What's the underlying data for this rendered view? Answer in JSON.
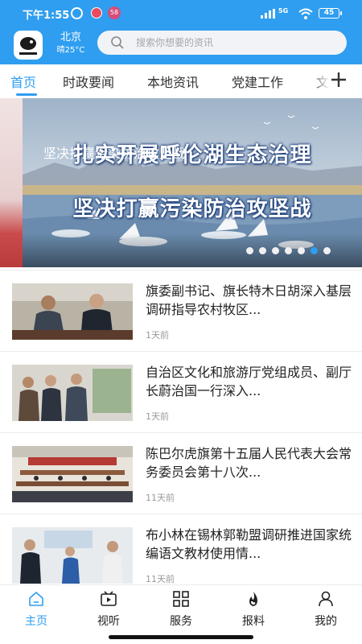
{
  "status_bar": {
    "time": "下午1:55",
    "app_badge_1": "",
    "app_badge_2": "58",
    "battery": "45",
    "network_label": "5G"
  },
  "header": {
    "city": "北京",
    "weather": "晴25°C",
    "search_placeholder": "搜索你想要的资讯",
    "accent_color": "#2f9ef0"
  },
  "tabs": [
    {
      "label": "首页",
      "active": true
    },
    {
      "label": "时政要闻",
      "active": false
    },
    {
      "label": "本地资讯",
      "active": false
    },
    {
      "label": "党建工作",
      "active": false
    },
    {
      "label": "文",
      "active": false
    }
  ],
  "banner": {
    "headline_line1": "扎实开展呼伦湖生态治理",
    "headline_line2": "坚决打赢污染防治攻坚战",
    "caption": "坚决打赢污染防治攻坚战",
    "slide_count": 7,
    "active_slide": 6
  },
  "news": [
    {
      "title": "旗委副书记、旗长特木日胡深入基层调研指导农村牧区...",
      "time": "1天前",
      "thumb": "meeting-two-men"
    },
    {
      "title": "自治区文化和旅游厅党组成员、副厅长蔚治国一行深入...",
      "time": "1天前",
      "thumb": "exhibition-visit"
    },
    {
      "title": "陈巴尔虎旗第十五届人民代表大会常务委员会第十八次...",
      "time": "11天前",
      "thumb": "conference-hall"
    },
    {
      "title": "布小林在锡林郭勒盟调研推进国家统编语文教材使用情...",
      "time": "11天前",
      "thumb": "school-visit"
    }
  ],
  "bottom_nav": [
    {
      "label": "主页",
      "icon": "home-icon",
      "active": true
    },
    {
      "label": "视听",
      "icon": "video-icon",
      "active": false
    },
    {
      "label": "服务",
      "icon": "grid-icon",
      "active": false
    },
    {
      "label": "报料",
      "icon": "fire-icon",
      "active": false
    },
    {
      "label": "我的",
      "icon": "user-icon",
      "active": false
    }
  ]
}
